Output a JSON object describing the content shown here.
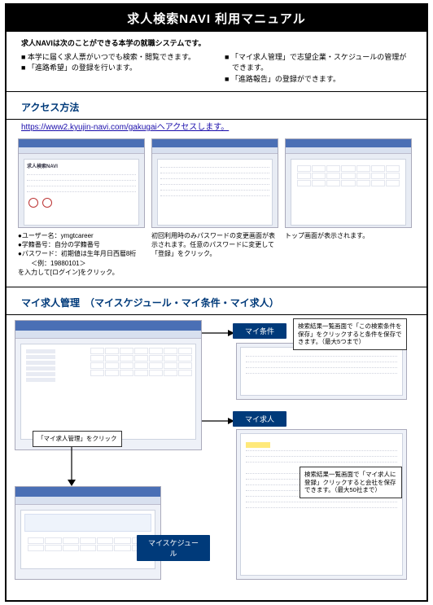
{
  "title": "求人検索NAVI 利用マニュアル",
  "intro": {
    "lead": "求人NAVIは次のことができる本学の就職システムです。",
    "left": [
      "■ 本学に届く求人票がいつでも検索・閲覧できます。",
      "■ 「進路希望」の登録を行います。"
    ],
    "right": [
      "■ 「マイ求人管理」で志望企業・スケジュールの管理ができます。",
      "■ 「進路報告」の登録ができます。"
    ]
  },
  "access": {
    "heading": "アクセス方法",
    "url_text": "https://www2.kyujin-navi.com/gakugaiへアクセスします。",
    "url_href": "https://www2.kyujin-navi.com/gakugai",
    "shot1_label": "求人検索NAVI",
    "cap1": "●ユーザー名：ymgtcareer\n●学籍番号：自分の学籍番号\n●パスワード：初期値は生年月日西暦8桁\n　　＜例：19880101＞\nを入力して[ログイン]をクリック。",
    "cap2": "初回利用時のみパスワードの変更画面が表示されます。任意のパスワードに変更して「登録」をクリック。",
    "cap3": "トップ画面が表示されます。"
  },
  "manage": {
    "heading": "マイ求人管理　（マイスケジュール・マイ条件・マイ求人）",
    "tag_myjoken": "マイ条件",
    "tag_mykyujin": "マイ求人",
    "tag_myschedule": "マイスケジュール",
    "callout_main": "「マイ求人管理」をクリック",
    "note1": "検索結果一覧画面で「この検索条件を保存」をクリックすると条件を保存できます。（最大5つまで）",
    "note2": "検索結果一覧画面で「マイ求人に登録」クリックすると会社を保存できます。（最大50社まで）"
  }
}
